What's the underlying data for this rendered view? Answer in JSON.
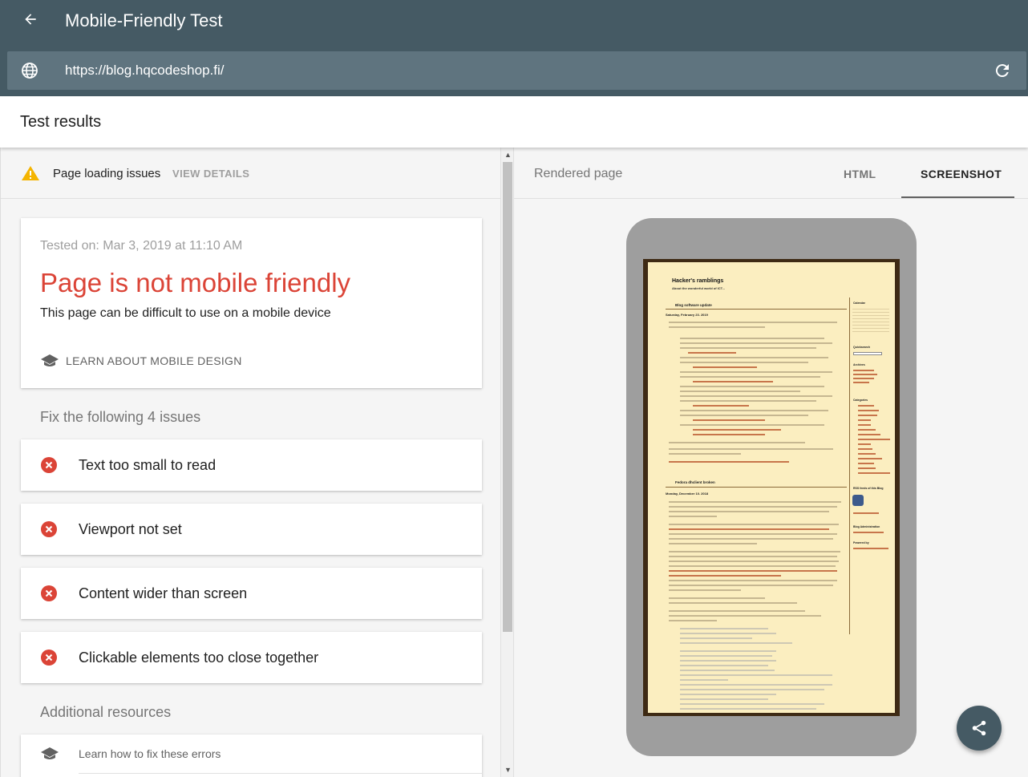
{
  "appbar": {
    "title": "Mobile-Friendly Test",
    "back_icon": "arrow-back-icon",
    "url": "https://blog.hqcodeshop.fi/",
    "globe_icon": "globe-icon",
    "reload_icon": "reload-icon"
  },
  "results": {
    "title": "Test results"
  },
  "loading_issues": {
    "label": "Page loading issues",
    "action": "VIEW DETAILS",
    "icon": "warning-icon",
    "color": "#f4b400"
  },
  "summary": {
    "tested_on": "Tested on: Mar 3, 2019 at 11:10 AM",
    "verdict": "Page is not mobile friendly",
    "subtitle": "This page can be difficult to use on a mobile device",
    "learn_link": "LEARN ABOUT MOBILE DESIGN",
    "verdict_color": "#db4437"
  },
  "fix": {
    "title": "Fix the following 4 issues",
    "issues": [
      {
        "label": "Text too small to read"
      },
      {
        "label": "Viewport not set"
      },
      {
        "label": "Content wider than screen"
      },
      {
        "label": "Clickable elements too close together"
      }
    ]
  },
  "resources": {
    "title": "Additional resources",
    "items": [
      {
        "label": "Learn how to fix these errors"
      }
    ]
  },
  "right_panel": {
    "rendered_label": "Rendered page",
    "tabs": [
      {
        "label": "HTML",
        "active": false
      },
      {
        "label": "SCREENSHOT",
        "active": true
      }
    ]
  },
  "preview": {
    "blog_title": "Hacker's ramblings",
    "blog_subtitle": "About the wonderful world of ICT...",
    "post1_title": "Blog software update",
    "post1_date": "Saturday, February 23. 2019",
    "post2_title": "Fedora dhclient broken",
    "post2_date": "Monday, December 10. 2018",
    "side_calendar": "Calendar",
    "side_quicksearch": "Quicksearch",
    "side_archives": "Archives",
    "side_categories": "Categories",
    "side_rss": "RSS feeds of this Blog",
    "side_admin": "Blog Administration",
    "side_powered": "Powered by"
  },
  "fab": {
    "icon": "share-icon"
  }
}
